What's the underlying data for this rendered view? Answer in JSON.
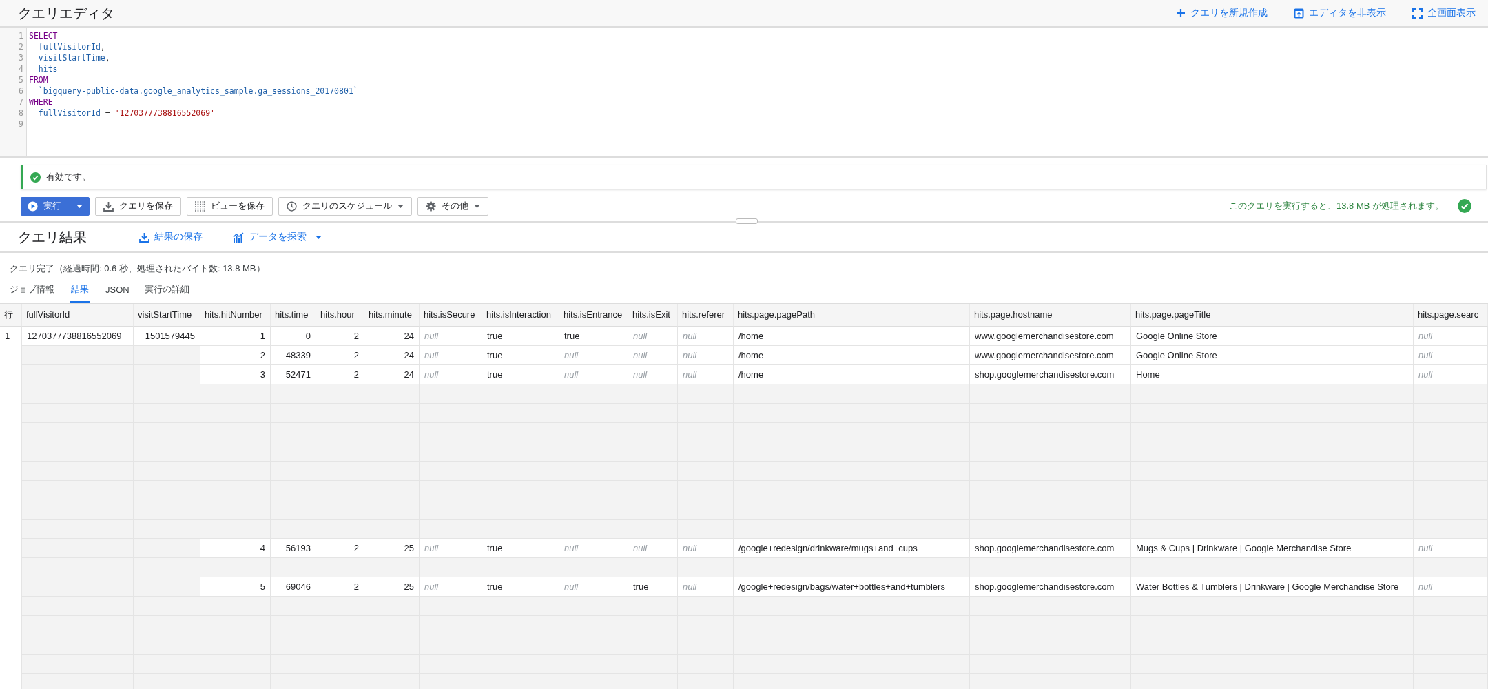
{
  "header": {
    "title": "クエリエディタ",
    "actions": [
      {
        "kind": "new",
        "label": "クエリを新規作成"
      },
      {
        "kind": "hide",
        "label": "エディタを非表示"
      },
      {
        "kind": "fullscreen",
        "label": "全画面表示"
      }
    ]
  },
  "editor": {
    "lines": [
      {
        "number": "1",
        "tokens": [
          {
            "text": "SELECT",
            "kind": "keyword"
          }
        ]
      },
      {
        "number": "2",
        "tokens": [
          {
            "text": "  fullVisitorId",
            "kind": "ident"
          },
          {
            "text": ",",
            "kind": "plain"
          }
        ]
      },
      {
        "number": "3",
        "tokens": [
          {
            "text": "  visitStartTime",
            "kind": "ident"
          },
          {
            "text": ",",
            "kind": "plain"
          }
        ]
      },
      {
        "number": "4",
        "tokens": [
          {
            "text": "  hits",
            "kind": "ident"
          }
        ]
      },
      {
        "number": "5",
        "tokens": [
          {
            "text": "FROM",
            "kind": "keyword"
          }
        ]
      },
      {
        "number": "6",
        "tokens": [
          {
            "text": "  `bigquery-public-data.google_analytics_sample.ga_sessions_20170801`",
            "kind": "ident"
          }
        ]
      },
      {
        "number": "7",
        "tokens": [
          {
            "text": "WHERE",
            "kind": "keyword"
          }
        ]
      },
      {
        "number": "8",
        "tokens": [
          {
            "text": "  fullVisitorId",
            "kind": "ident"
          },
          {
            "text": " = ",
            "kind": "plain"
          },
          {
            "text": "'1270377738816552069'",
            "kind": "string"
          }
        ]
      },
      {
        "number": "9"
      }
    ]
  },
  "validation": {
    "message": "有効です。"
  },
  "toolbar": {
    "buttons": [
      {
        "kind": "run",
        "label": "実行",
        "dropdown": true
      },
      {
        "kind": "save_query",
        "label": "クエリを保存",
        "dropdown": false
      },
      {
        "kind": "save_view",
        "label": "ビューを保存",
        "dropdown": false
      },
      {
        "kind": "schedule",
        "label": "クエリのスケジュール",
        "dropdown": true
      },
      {
        "kind": "more",
        "label": "その他",
        "dropdown": true
      }
    ],
    "estimate": "このクエリを実行すると、13.8 MB が処理されます。"
  },
  "results": {
    "title": "クエリ結果",
    "actions": [
      {
        "kind": "save",
        "label": "結果の保存",
        "dropdown": false
      },
      {
        "kind": "explore",
        "label": "データを探索",
        "dropdown": true
      }
    ],
    "status": "クエリ完了（経過時間: 0.6 秒、処理されたバイト数: 13.8 MB）",
    "tabs": [
      {
        "label": "ジョブ情報",
        "selected": false
      },
      {
        "label": "結果",
        "selected": true
      },
      {
        "label": "JSON",
        "selected": false
      },
      {
        "label": "実行の詳細",
        "selected": false
      }
    ]
  },
  "table": {
    "columns": [
      "行",
      "fullVisitorId",
      "visitStartTime",
      "hits.hitNumber",
      "hits.time",
      "hits.hour",
      "hits.minute",
      "hits.isSecure",
      "hits.isInteraction",
      "hits.isEntrance",
      "hits.isExit",
      "hits.referer",
      "hits.page.pagePath",
      "hits.page.hostname",
      "hits.page.pageTitle",
      "hits.page.searc"
    ],
    "rows": [
      {
        "kind": "record",
        "row_number": "1",
        "cells": [
          {
            "text": "1270377738816552069",
            "kind": "text"
          },
          {
            "text": "1501579445",
            "kind": "number"
          },
          {
            "text": "1",
            "kind": "number"
          },
          {
            "text": "0",
            "kind": "number"
          },
          {
            "text": "2",
            "kind": "number"
          },
          {
            "text": "24",
            "kind": "number"
          },
          {
            "text": "null",
            "kind": "null"
          },
          {
            "text": "true",
            "kind": "text"
          },
          {
            "text": "true",
            "kind": "text"
          },
          {
            "text": "null",
            "kind": "null"
          },
          {
            "text": "null",
            "kind": "null"
          },
          {
            "text": "/home",
            "kind": "text"
          },
          {
            "text": "www.googlemerchandisestore.com",
            "kind": "text"
          },
          {
            "text": "Google Online Store",
            "kind": "text"
          },
          {
            "text": "null",
            "kind": "null"
          }
        ]
      },
      {
        "kind": "hit",
        "cells": [
          {
            "text": "2",
            "kind": "number"
          },
          {
            "text": "48339",
            "kind": "number"
          },
          {
            "text": "2",
            "kind": "number"
          },
          {
            "text": "24",
            "kind": "number"
          },
          {
            "text": "null",
            "kind": "null"
          },
          {
            "text": "true",
            "kind": "text"
          },
          {
            "text": "null",
            "kind": "null"
          },
          {
            "text": "null",
            "kind": "null"
          },
          {
            "text": "null",
            "kind": "null"
          },
          {
            "text": "/home",
            "kind": "text"
          },
          {
            "text": "www.googlemerchandisestore.com",
            "kind": "text"
          },
          {
            "text": "Google Online Store",
            "kind": "text"
          },
          {
            "text": "null",
            "kind": "null"
          }
        ]
      },
      {
        "kind": "hit",
        "cells": [
          {
            "text": "3",
            "kind": "number"
          },
          {
            "text": "52471",
            "kind": "number"
          },
          {
            "text": "2",
            "kind": "number"
          },
          {
            "text": "24",
            "kind": "number"
          },
          {
            "text": "null",
            "kind": "null"
          },
          {
            "text": "true",
            "kind": "text"
          },
          {
            "text": "null",
            "kind": "null"
          },
          {
            "text": "null",
            "kind": "null"
          },
          {
            "text": "null",
            "kind": "null"
          },
          {
            "text": "/home",
            "kind": "text"
          },
          {
            "text": "shop.googlemerchandisestore.com",
            "kind": "text"
          },
          {
            "text": "Home",
            "kind": "text"
          },
          {
            "text": "null",
            "kind": "null"
          }
        ]
      },
      {
        "kind": "blank"
      },
      {
        "kind": "blank"
      },
      {
        "kind": "blank"
      },
      {
        "kind": "blank"
      },
      {
        "kind": "blank"
      },
      {
        "kind": "blank"
      },
      {
        "kind": "blank"
      },
      {
        "kind": "blank"
      },
      {
        "kind": "hit",
        "cells": [
          {
            "text": "4",
            "kind": "number"
          },
          {
            "text": "56193",
            "kind": "number"
          },
          {
            "text": "2",
            "kind": "number"
          },
          {
            "text": "25",
            "kind": "number"
          },
          {
            "text": "null",
            "kind": "null"
          },
          {
            "text": "true",
            "kind": "text"
          },
          {
            "text": "null",
            "kind": "null"
          },
          {
            "text": "null",
            "kind": "null"
          },
          {
            "text": "null",
            "kind": "null"
          },
          {
            "text": "/google+redesign/drinkware/mugs+and+cups",
            "kind": "text"
          },
          {
            "text": "shop.googlemerchandisestore.com",
            "kind": "text"
          },
          {
            "text": "Mugs & Cups | Drinkware | Google Merchandise Store",
            "kind": "text"
          },
          {
            "text": "null",
            "kind": "null"
          }
        ]
      },
      {
        "kind": "blank"
      },
      {
        "kind": "hit",
        "cells": [
          {
            "text": "5",
            "kind": "number"
          },
          {
            "text": "69046",
            "kind": "number"
          },
          {
            "text": "2",
            "kind": "number"
          },
          {
            "text": "25",
            "kind": "number"
          },
          {
            "text": "null",
            "kind": "null"
          },
          {
            "text": "true",
            "kind": "text"
          },
          {
            "text": "null",
            "kind": "null"
          },
          {
            "text": "true",
            "kind": "text"
          },
          {
            "text": "null",
            "kind": "null"
          },
          {
            "text": "/google+redesign/bags/water+bottles+and+tumblers",
            "kind": "text"
          },
          {
            "text": "shop.googlemerchandisestore.com",
            "kind": "text"
          },
          {
            "text": "Water Bottles & Tumblers | Drinkware | Google Merchandise Store",
            "kind": "text"
          },
          {
            "text": "null",
            "kind": "null"
          }
        ]
      },
      {
        "kind": "blank"
      },
      {
        "kind": "blank"
      },
      {
        "kind": "blank"
      },
      {
        "kind": "blank"
      },
      {
        "kind": "blank"
      }
    ]
  }
}
